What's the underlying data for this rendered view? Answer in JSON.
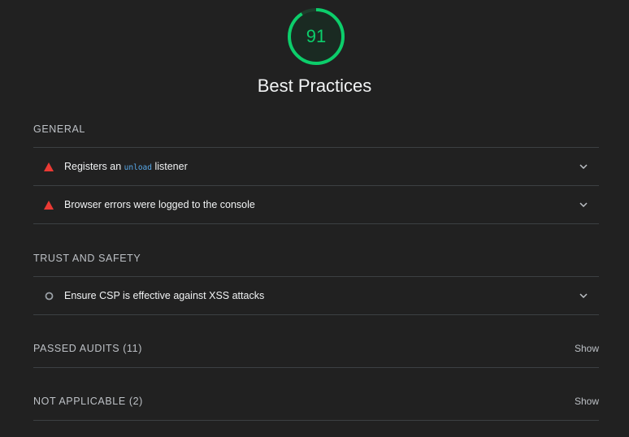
{
  "score": {
    "value": "91",
    "fraction": 0.91,
    "color": "#0cce6b",
    "track_color": "#1b3a2a"
  },
  "category": {
    "title": "Best Practices"
  },
  "groups": {
    "general": {
      "title": "GENERAL",
      "audits": [
        {
          "prefix": "Registers an ",
          "code": "unload",
          "suffix": " listener",
          "status": "fail",
          "icon": "triangle-warning-icon"
        },
        {
          "title": "Browser errors were logged to the console",
          "status": "fail",
          "icon": "triangle-warning-icon"
        }
      ]
    },
    "trust": {
      "title": "TRUST AND SAFETY",
      "audits": [
        {
          "title": "Ensure CSP is effective against XSS attacks",
          "status": "informative",
          "icon": "circle-outline-icon"
        }
      ]
    }
  },
  "passed": {
    "label": "PASSED AUDITS (11)",
    "show_label": "Show"
  },
  "not_applicable": {
    "label": "NOT APPLICABLE (2)",
    "show_label": "Show"
  },
  "colors": {
    "fail": "#eb3a34",
    "informative": "#9aa0a6",
    "background": "#212121"
  }
}
